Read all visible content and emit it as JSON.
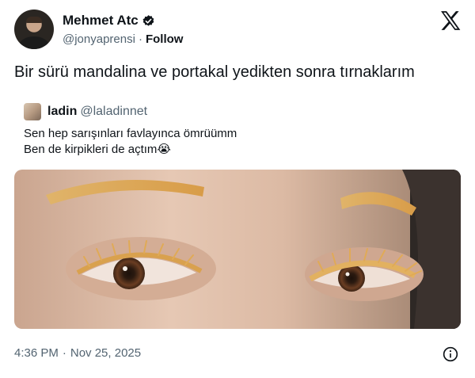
{
  "author": {
    "display_name": "Mehmet Atc",
    "handle": "@jonyaprensi",
    "separator": "·",
    "follow_label": "Follow"
  },
  "tweet": {
    "text": "Bir sürü mandalina ve portakal yedikten sonra tırnaklarım"
  },
  "quote": {
    "name": "ladin",
    "handle": "@laladinnet",
    "line1": "Sen hep sarışınları favlayınca ömrüümm",
    "line2": "Ben de kirpikleri de açtım😭"
  },
  "footer": {
    "time": "4:36 PM",
    "separator": "·",
    "date": "Nov 25, 2025"
  },
  "icons": {
    "verified": "verified-badge-icon",
    "brand": "x-logo-icon",
    "info": "info-icon"
  },
  "colors": {
    "text": "#0f1419",
    "secondary_text": "#536471",
    "background": "#ffffff"
  }
}
